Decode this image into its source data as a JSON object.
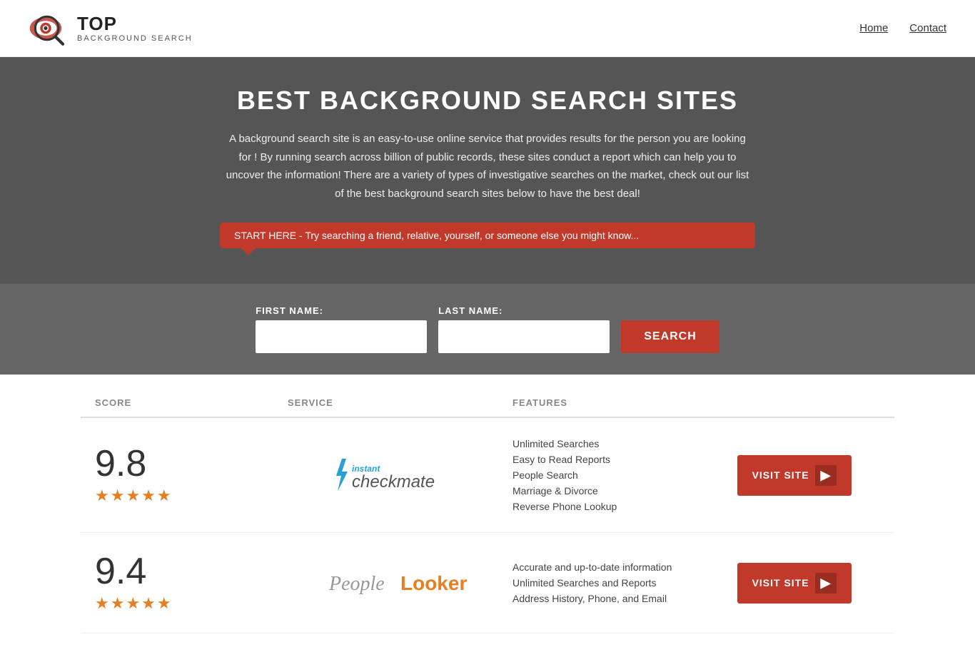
{
  "header": {
    "logo_top": "TOP",
    "logo_bottom": "BACKGROUND SEARCH",
    "nav": [
      {
        "label": "Home",
        "href": "#"
      },
      {
        "label": "Contact",
        "href": "#"
      }
    ]
  },
  "hero": {
    "title": "BEST BACKGROUND SEARCH SITES",
    "description": "A background search site is an easy-to-use online service that provides results  for the person you are looking for ! By  running  search across billion of public records, these sites conduct  a report which can help you to uncover the information! There are a variety of types of investigative searches on the market, check out our  list of the best background search sites below to have the best deal!",
    "tooltip": "START HERE - Try searching a friend, relative, yourself, or someone else you might know...",
    "first_name_label": "FIRST NAME:",
    "last_name_label": "LAST NAME:",
    "search_button": "SEARCH"
  },
  "table": {
    "headers": [
      "SCORE",
      "SERVICE",
      "FEATURES",
      ""
    ],
    "rows": [
      {
        "score": "9.8",
        "stars": "★★★★★",
        "service_name": "Instant Checkmate",
        "features": [
          "Unlimited Searches",
          "Easy to Read Reports",
          "People Search",
          "Marriage & Divorce",
          "Reverse Phone Lookup"
        ],
        "visit_label": "VISIT SITE"
      },
      {
        "score": "9.4",
        "stars": "★★★★★",
        "service_name": "PeopleLooker",
        "features": [
          "Accurate and up-to-date information",
          "Unlimited Searches and Reports",
          "Address History, Phone, and Email"
        ],
        "visit_label": "VISIT SITE"
      }
    ]
  }
}
